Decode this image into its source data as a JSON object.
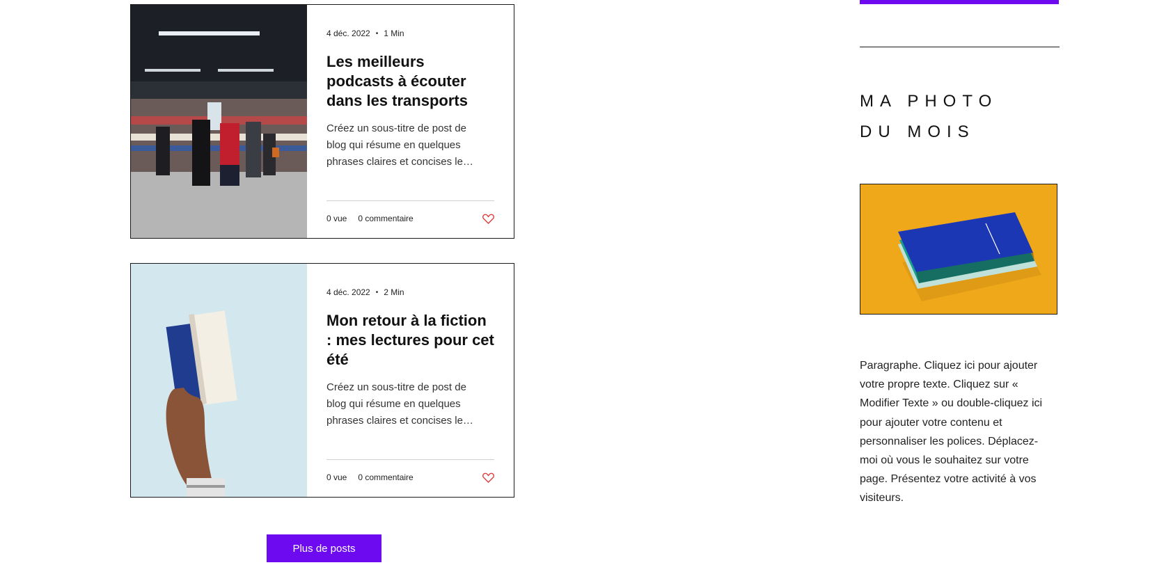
{
  "posts": [
    {
      "date": "4 déc. 2022",
      "read_time": "1 Min",
      "title": "Les meilleurs podcasts à écouter dans les transports",
      "excerpt": "Créez un sous-titre de post de blog qui résume en quelques phrases claires et concises le…",
      "views": "0 vue",
      "comments": "0 commentaire",
      "image_icon": "metro-platform-photo"
    },
    {
      "date": "4 déc. 2022",
      "read_time": "2 Min",
      "title": "Mon retour à la fiction : mes lectures pour cet été",
      "excerpt": "Créez un sous-titre de post de blog qui résume en quelques phrases claires et concises le…",
      "views": "0 vue",
      "comments": "0 commentaire",
      "image_icon": "hand-holding-book-photo"
    }
  ],
  "more_posts_label": "Plus de posts",
  "sidebar": {
    "heading_line1": "MA PHOTO",
    "heading_line2": "DU MOIS",
    "photo_icon": "blue-book-photo",
    "paragraph": "Paragraphe. Cliquez ici pour ajouter votre propre texte. Cliquez sur « Modifier Texte » ou double-cliquez ici pour ajouter votre contenu et personnaliser les polices. Déplacez-moi où vous le souhaitez sur votre page. Présentez votre activité à vos visiteurs."
  },
  "colors": {
    "accent": "#6d0aef",
    "like_heart": "#e03c3c",
    "photo_background": "#f0a81b"
  }
}
